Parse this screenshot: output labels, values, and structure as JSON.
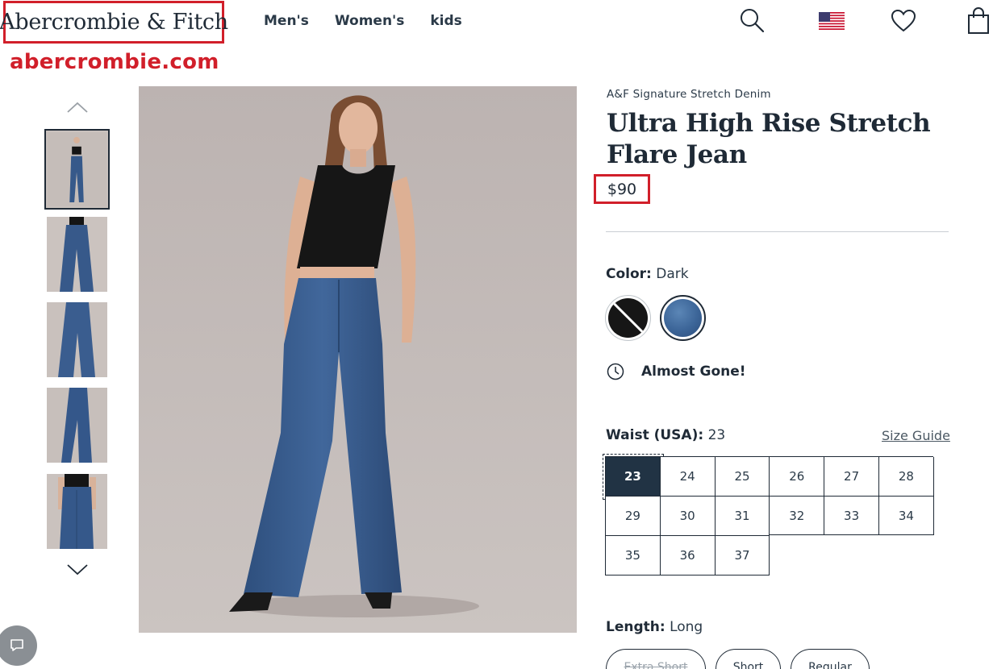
{
  "header": {
    "logo_text": "Abercrombie & Fitch",
    "domain_text": "abercrombie.com",
    "nav": [
      "Men's",
      "Women's",
      "kids"
    ],
    "icons": [
      "search-icon",
      "us-flag-icon",
      "heart-icon",
      "shopping-bag-icon"
    ]
  },
  "gallery": {
    "thumbnail_count": 5,
    "selected_index": 0,
    "icons": [
      "chevron-up-icon",
      "chevron-down-icon"
    ]
  },
  "product": {
    "brand_line": "A&F Signature Stretch Denim",
    "title": "Ultra High Rise Stretch Flare Jean",
    "price": "$90",
    "color_label": "Color:",
    "color_value": "Dark",
    "swatches": [
      "black",
      "dark"
    ],
    "selected_swatch": "dark",
    "stock_message": "Almost Gone!",
    "waist_label": "Waist (USA):",
    "waist_value": "23",
    "size_guide": "Size Guide",
    "sizes": [
      "23",
      "24",
      "25",
      "26",
      "27",
      "28",
      "29",
      "30",
      "31",
      "32",
      "33",
      "34",
      "35",
      "36",
      "37"
    ],
    "selected_size": "23",
    "length_label": "Length:",
    "length_value": "Long",
    "lengths": [
      "Extra Short",
      "Short",
      "Regular"
    ]
  },
  "colors": {
    "accent_red": "#d11f2a",
    "text_dark": "#1f2a36",
    "selected_size_bg": "#213344",
    "denim": "#3c6598"
  }
}
